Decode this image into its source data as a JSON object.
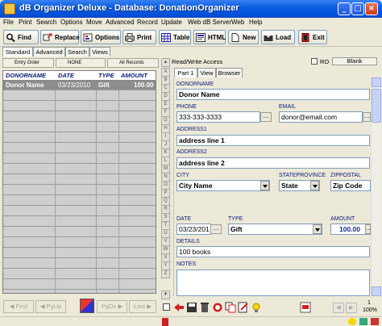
{
  "window": {
    "title": "dB Organizer Deluxe - Database: DonationOrganizer"
  },
  "menu": [
    "File",
    "Print",
    "Search",
    "Options",
    "Move",
    "Advanced",
    "Record",
    "Update",
    "Web dB Server",
    "Web",
    "Help"
  ],
  "toolbar": {
    "find": "Find",
    "replace": "Replace",
    "options": "Options",
    "print": "Print",
    "table": "Table",
    "html": "HTML",
    "new": "New",
    "load": "Load",
    "exit": "Exit"
  },
  "left_tabs": [
    "Standard",
    "Advanced",
    "Search",
    "Views"
  ],
  "sort_bar": {
    "entry_order": "Entry Order",
    "none": "NONE",
    "all_records": "All Records"
  },
  "grid": {
    "columns": [
      "DONORNAME",
      "DATE",
      "TYPE",
      "AMOUNT"
    ],
    "rows": [
      [
        "Donor Name",
        "03/23/2010",
        "Gift",
        "100.00"
      ]
    ]
  },
  "left_nav": {
    "first": "First",
    "pgup": "PgUp",
    "pgdn": "PgDn",
    "last": "Last"
  },
  "alphabet": [
    "A",
    "B",
    "C",
    "D",
    "E",
    "F",
    "G",
    "H",
    "I",
    "J",
    "K",
    "L",
    "M",
    "N",
    "O",
    "P",
    "Q",
    "R",
    "S",
    "T",
    "U",
    "V",
    "W",
    "X",
    "Y",
    "Z"
  ],
  "right_header": {
    "access": "Read/Write Access",
    "ro": "RO",
    "blank": "Blank"
  },
  "right_tabs": [
    "Part 1",
    "View",
    "Browser"
  ],
  "form": {
    "donorname_label": "DONORNAME",
    "donorname": "Donor Name",
    "phone_label": "PHONE",
    "phone": "333-333-3333",
    "email_label": "EMAIL",
    "email": "donor@email.com",
    "address1_label": "ADDRESS1",
    "address1": "address line 1",
    "address2_label": "ADDRESS2",
    "address2": "address line 2",
    "city_label": "CITY",
    "city": "City Name",
    "state_label": "STATEPROVINCE",
    "state": "State",
    "zip_label": "ZIPPOSTAL",
    "zip": "Zip Code",
    "date_label": "DATE",
    "date": "03/23/201",
    "type_label": "TYPE",
    "type": "Gift",
    "amount_label": "AMOUNT",
    "amount": "100.00",
    "details_label": "DETAILS",
    "details": "100 books",
    "notes_label": "NOTES",
    "notes": ""
  },
  "status": {
    "count": "1",
    "zoom": "100%",
    "ellipsis": "..."
  },
  "colors": {
    "title_blue": "#0050D8",
    "label_blue": "#0A1A7A",
    "selected_row": "#8D8D8D"
  }
}
